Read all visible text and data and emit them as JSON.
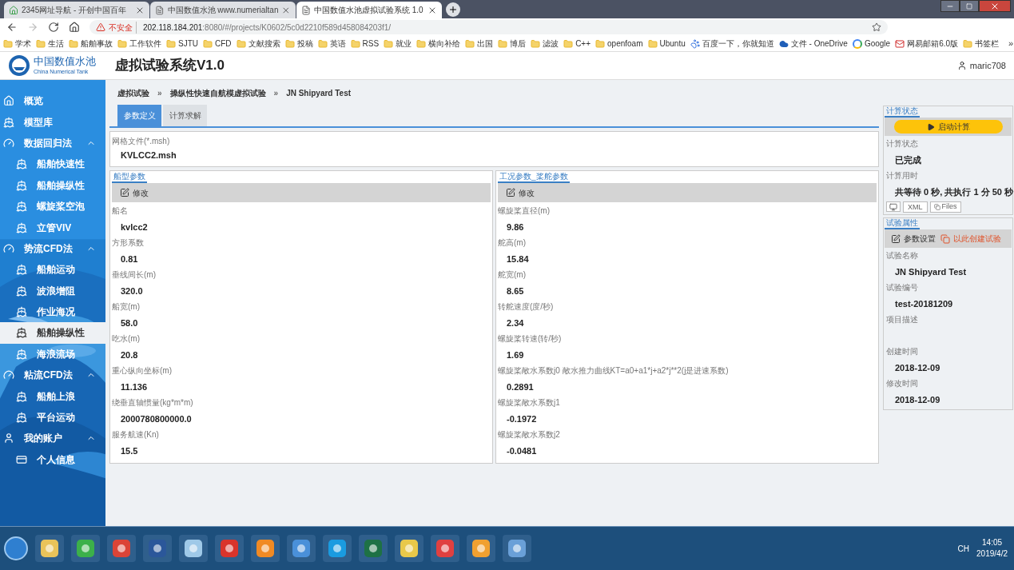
{
  "browser": {
    "tabs": [
      {
        "title": "2345网址导航 - 开创中国百年",
        "kind": "site",
        "selected": false
      },
      {
        "title": "中国数值水池 www.numerialtan",
        "kind": "page",
        "selected": false
      },
      {
        "title": "中国数值水池虚拟试验系统 1.0",
        "kind": "page",
        "selected": true
      }
    ],
    "address": {
      "security": "不安全",
      "host": "202.118.184.201",
      "path": ":8080/#/projects/K0602/5c0d2210f589d458084203f1/"
    },
    "bookmarks": [
      {
        "label": "学术",
        "kind": "folder"
      },
      {
        "label": "生活",
        "kind": "folder"
      },
      {
        "label": "船舶事故",
        "kind": "folder"
      },
      {
        "label": "工作软件",
        "kind": "folder"
      },
      {
        "label": "SJTU",
        "kind": "folder"
      },
      {
        "label": "CFD",
        "kind": "folder"
      },
      {
        "label": "文献搜索",
        "kind": "folder"
      },
      {
        "label": "投稿",
        "kind": "folder"
      },
      {
        "label": "英语",
        "kind": "folder"
      },
      {
        "label": "RSS",
        "kind": "folder"
      },
      {
        "label": "就业",
        "kind": "folder"
      },
      {
        "label": "横向补给",
        "kind": "folder"
      },
      {
        "label": "出国",
        "kind": "folder"
      },
      {
        "label": "博后",
        "kind": "folder"
      },
      {
        "label": "滤波",
        "kind": "folder"
      },
      {
        "label": "C++",
        "kind": "folder"
      },
      {
        "label": "openfoam",
        "kind": "folder"
      },
      {
        "label": "Ubuntu",
        "kind": "folder"
      },
      {
        "label": "百度一下，你就知道",
        "kind": "paw"
      },
      {
        "label": "文件 - OneDrive",
        "kind": "cloud"
      },
      {
        "label": "Google",
        "kind": "google"
      },
      {
        "label": "网易邮箱6.0版",
        "kind": "mail"
      },
      {
        "label": "书签栏",
        "kind": "folder"
      }
    ],
    "bookmarks_more": "»"
  },
  "app": {
    "logo_cn": "中国数值水池",
    "logo_en": "China Numerical Tank",
    "title": "虚拟试验系统V1.0",
    "user": "maric708"
  },
  "sidebar": {
    "items": [
      {
        "label": "概览",
        "kind": "home",
        "selected": false
      },
      {
        "label": "模型库",
        "kind": "ship",
        "selected": false
      },
      {
        "label": "数据回归法",
        "kind": "gauge",
        "selected": false,
        "expanded": true,
        "children": [
          {
            "label": "船舶快速性",
            "kind": "ship",
            "selected": false
          },
          {
            "label": "船舶操纵性",
            "kind": "ship",
            "selected": false
          },
          {
            "label": "螺旋桨空泡",
            "kind": "ship",
            "selected": false
          },
          {
            "label": "立管VIV",
            "kind": "ship",
            "selected": false
          }
        ]
      },
      {
        "label": "势流CFD法",
        "kind": "gauge",
        "selected": false,
        "expanded": true,
        "children": [
          {
            "label": "船舶运动",
            "kind": "ship",
            "selected": false
          },
          {
            "label": "波浪增阻",
            "kind": "ship",
            "selected": false
          },
          {
            "label": "作业海况",
            "kind": "ship",
            "selected": false
          },
          {
            "label": "船舶操纵性",
            "kind": "ship",
            "selected": true
          },
          {
            "label": "海浪流场",
            "kind": "ship",
            "selected": false
          }
        ]
      },
      {
        "label": "粘流CFD法",
        "kind": "gauge",
        "selected": false,
        "expanded": true,
        "children": [
          {
            "label": "船舶上浪",
            "kind": "ship",
            "selected": false
          },
          {
            "label": "平台运动",
            "kind": "ship",
            "selected": false
          }
        ]
      },
      {
        "label": "我的账户",
        "kind": "user",
        "selected": false,
        "expanded": true,
        "children": [
          {
            "label": "个人信息",
            "kind": "card",
            "selected": false
          }
        ]
      }
    ]
  },
  "breadcrumb": [
    {
      "label": "虚拟试验",
      "separator": "»"
    },
    {
      "label": "操纵性快速自航模虚拟试验",
      "separator": "»"
    },
    {
      "label": "JN Shipyard Test"
    }
  ],
  "tabs": [
    {
      "label": "参数定义",
      "selected": true
    },
    {
      "label": "计算求解",
      "selected": false
    }
  ],
  "mesh_file": {
    "label": "网格文件(*.msh)",
    "value": "KVLCC2.msh"
  },
  "panels": [
    {
      "title": "船型参数",
      "action": "修改",
      "fields": [
        {
          "label": "船名",
          "value": "kvlcc2"
        },
        {
          "label": "方形系数",
          "value": "0.81"
        },
        {
          "label": "垂线间长(m)",
          "value": "320.0"
        },
        {
          "label": "船宽(m)",
          "value": "58.0"
        },
        {
          "label": "吃水(m)",
          "value": "20.8"
        },
        {
          "label": "重心纵向坐标(m)",
          "value": "11.136"
        },
        {
          "label": "绕垂直轴惯量(kg*m*m)",
          "value": "2000780800000.0"
        },
        {
          "label": "服务航速(Kn)",
          "value": "15.5"
        }
      ]
    },
    {
      "title": "工况参数_桨舵参数",
      "action": "修改",
      "fields": [
        {
          "label": "螺旋桨直径(m)",
          "value": "9.86"
        },
        {
          "label": "舵高(m)",
          "value": "15.84"
        },
        {
          "label": "舵宽(m)",
          "value": "8.65"
        },
        {
          "label": "转舵速度(度/秒)",
          "value": "2.34"
        },
        {
          "label": "螺旋桨转速(转/秒)",
          "value": "1.69"
        },
        {
          "label": "螺旋桨敞水系数j0 敞水推力曲线KT=a0+a1*j+a2*j**2(j是进速系数)",
          "value": "0.2891"
        },
        {
          "label": "螺旋桨敞水系数j1",
          "value": "-0.1972"
        },
        {
          "label": "螺旋桨敞水系数j2",
          "value": "-0.0481"
        }
      ]
    }
  ],
  "status_panel": {
    "title": "计算状态",
    "run_button": "启动计算",
    "fields": [
      {
        "label": "计算状态",
        "value": "已完成"
      },
      {
        "label": "计算用时",
        "value": "共等待 0 秒, 共执行 1 分 50 秒"
      }
    ],
    "buttons": [
      {
        "kind": "monitor"
      },
      {
        "kind": "text",
        "label": "XML"
      },
      {
        "kind": "files",
        "label": "Files"
      }
    ]
  },
  "attributes_panel": {
    "title": "试验属性",
    "actions": [
      {
        "label": "参数设置",
        "kind": "edit"
      },
      {
        "label": "以此创建试验",
        "kind": "copy"
      }
    ],
    "fields": [
      {
        "label": "试验名称",
        "value": "JN Shipyard Test"
      },
      {
        "label": "试验编号",
        "value": "test-20181209"
      },
      {
        "label": "项目描述"
      },
      {
        "label": "创建时间",
        "value": "2018-12-09"
      },
      {
        "label": "修改时间",
        "value": "2018-12-09"
      }
    ]
  },
  "taskbar": {
    "apps": [
      {
        "kind": "folder"
      },
      {
        "kind": "ie"
      },
      {
        "kind": "chrome"
      },
      {
        "kind": "word"
      },
      {
        "kind": "notepad"
      },
      {
        "kind": "dict"
      },
      {
        "kind": "pdf"
      },
      {
        "kind": "star"
      },
      {
        "kind": "chat"
      },
      {
        "kind": "excel"
      },
      {
        "kind": "doc"
      },
      {
        "kind": "bird"
      },
      {
        "kind": "search"
      },
      {
        "kind": "paint"
      }
    ],
    "ime": "CH",
    "time": "14:05",
    "date": "2019/4/2"
  }
}
